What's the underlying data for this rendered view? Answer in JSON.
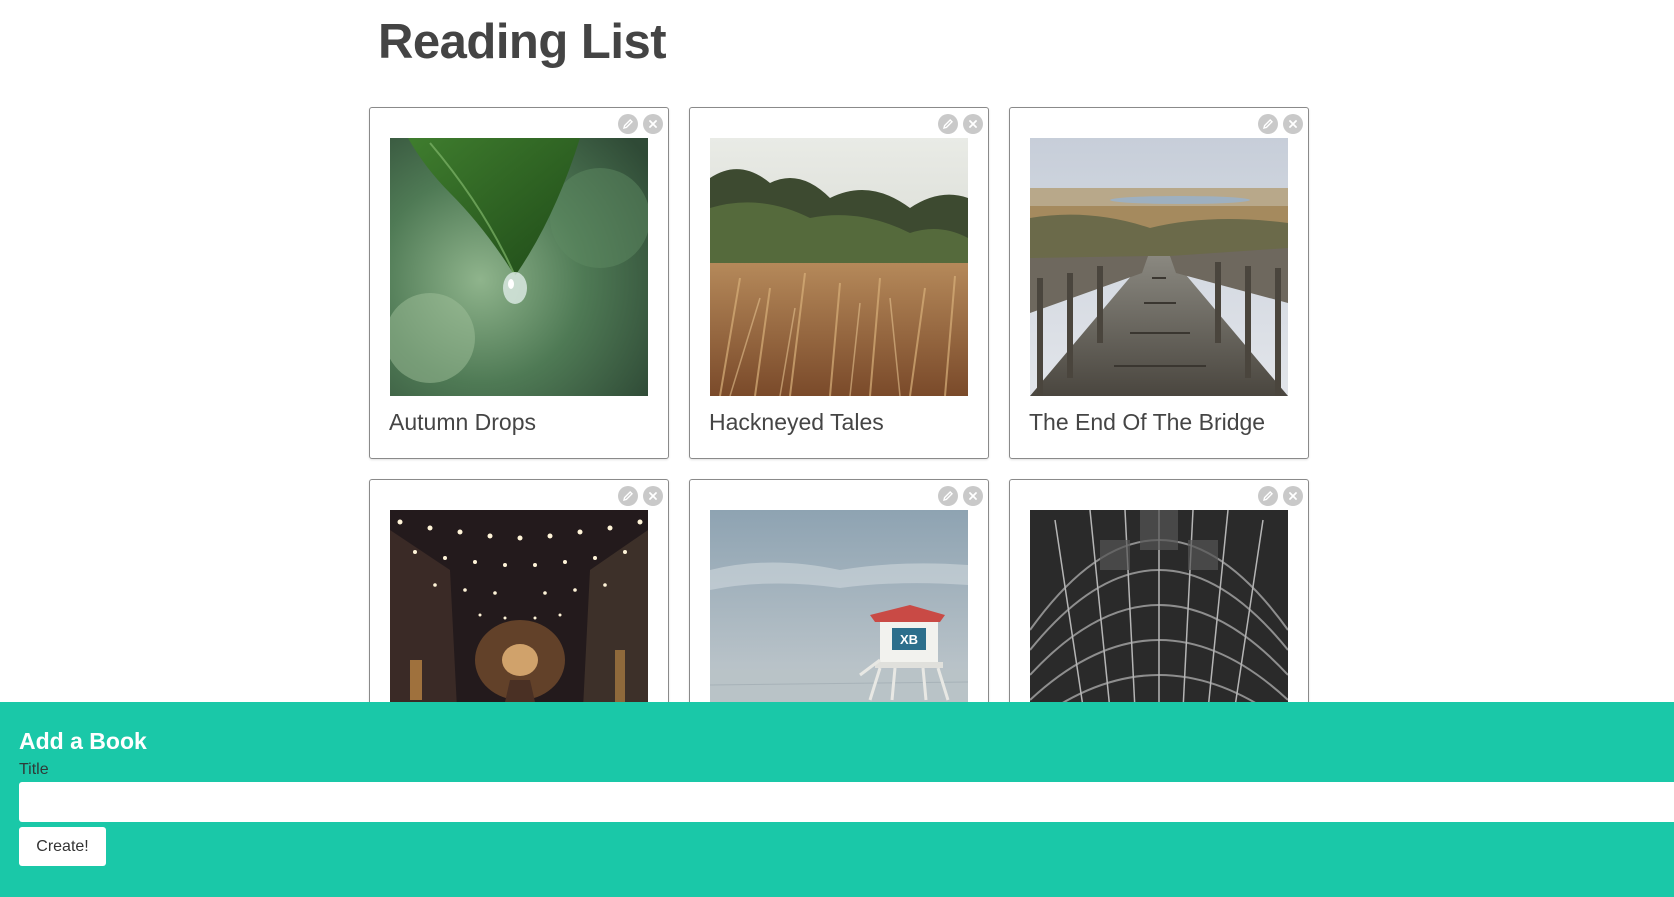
{
  "page": {
    "title": "Reading List"
  },
  "books": [
    {
      "title": "Autumn Drops",
      "cover": "leaf-water-drop"
    },
    {
      "title": "Hackneyed Tales",
      "cover": "dry-grass-field"
    },
    {
      "title": "The End Of The Bridge",
      "cover": "wooden-boardwalk"
    },
    {
      "title": "",
      "cover": "string-lights-street"
    },
    {
      "title": "",
      "cover": "lifeguard-tower"
    },
    {
      "title": "",
      "cover": "arched-steel-roof"
    }
  ],
  "card_actions": {
    "edit_icon": "pencil-icon",
    "delete_icon": "close-icon"
  },
  "add_form": {
    "heading": "Add a Book",
    "title_label": "Title",
    "title_value": "",
    "title_placeholder": "",
    "submit_label": "Create!"
  },
  "colors": {
    "accent": "#1ac8a8",
    "heading": "#444444",
    "card_border": "#8a8a8a",
    "action_icon_bg": "#c9c9c9"
  }
}
